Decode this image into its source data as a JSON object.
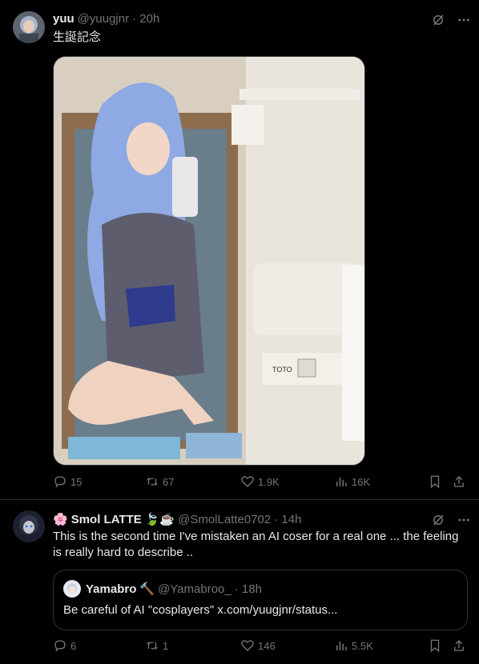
{
  "tweet1": {
    "display_name": "yuu",
    "handle": "@yuugjnr",
    "time": "· 20h",
    "text": "生誕記念",
    "stats": {
      "replies": "15",
      "retweets": "67",
      "likes": "1.9K",
      "views": "16K"
    }
  },
  "tweet2": {
    "name_prefix_emoji": "🌸",
    "display_name": "Smol LATTE",
    "name_suffix_emoji": "🍃☕",
    "handle": "@SmolLatte0702",
    "time": "· 14h",
    "text": "This is the second time I've mistaken an AI coser for a real one ... the feeling is really hard to describe ..",
    "quote": {
      "display_name": "Yamabro",
      "name_emoji": "🔨",
      "handle": "@Yamabroo_",
      "time": "· 18h",
      "text": "Be careful of AI \"cosplayers\" x.com/yuugjnr/status..."
    },
    "stats": {
      "replies": "6",
      "retweets": "1",
      "likes": "146",
      "views": "5.5K"
    }
  },
  "photo_label": "TOTO",
  "colors": {
    "background": "#000000",
    "text": "#e7e9ea",
    "muted": "#71767b",
    "border": "#2f3336"
  }
}
